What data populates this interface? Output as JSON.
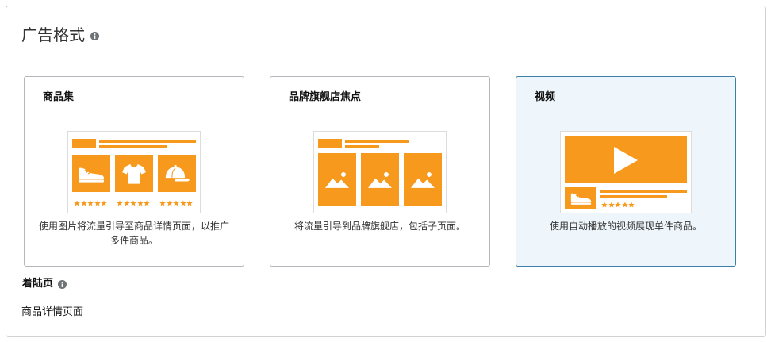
{
  "header": {
    "title": "广告格式",
    "info_icon": "info-icon"
  },
  "ad_formats": [
    {
      "title": "商品集",
      "description": "使用图片将流量引导至商品详情页面，以推广多件商品。",
      "selected": false,
      "illustration": {
        "tiles": [
          {
            "icon": "sneaker-icon",
            "rating": 5
          },
          {
            "icon": "tshirt-icon",
            "rating": 5
          },
          {
            "icon": "cap-icon",
            "rating": 5
          }
        ]
      }
    },
    {
      "title": "品牌旗舰店焦点",
      "description": "将流量引导到品牌旗舰店，包括子页面。",
      "selected": false,
      "illustration": {
        "tiles": [
          {
            "icon": "image-icon"
          },
          {
            "icon": "image-icon"
          },
          {
            "icon": "image-icon"
          }
        ]
      }
    },
    {
      "title": "视频",
      "description": "使用自动播放的视频展现单件商品。",
      "selected": true,
      "illustration": {
        "video_icon": "play-icon",
        "product": {
          "icon": "sneaker-icon",
          "rating": 5
        }
      }
    }
  ],
  "landing_page": {
    "label": "着陆页",
    "info_icon": "info-icon",
    "value": "商品详情页面"
  },
  "colors": {
    "accent": "#f7991c",
    "selected_border": "#3d7ea6",
    "selected_background": "#eef6fb"
  }
}
